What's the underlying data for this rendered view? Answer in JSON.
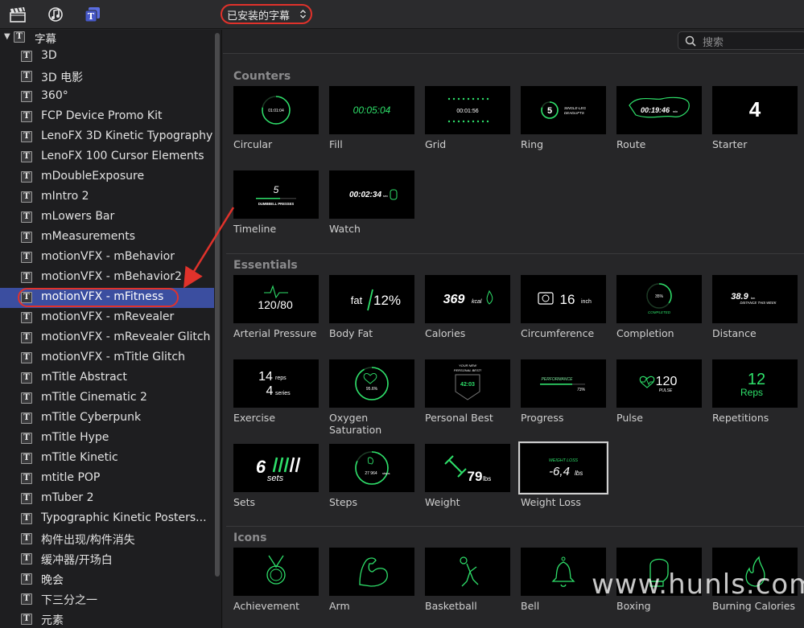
{
  "toolbar": {
    "icons": [
      "clapper-icon",
      "music-icon",
      "titles-icon"
    ],
    "selector_label": "已安装的字幕",
    "accent_color": "#e0322b"
  },
  "sidebar": {
    "header": "字幕",
    "items": [
      {
        "label": "3D"
      },
      {
        "label": "3D 电影"
      },
      {
        "label": "360°"
      },
      {
        "label": "FCP Device Promo Kit"
      },
      {
        "label": "LenoFX 3D Kinetic Typography"
      },
      {
        "label": "LenoFX 100 Cursor Elements"
      },
      {
        "label": "mDoubleExposure"
      },
      {
        "label": "mIntro 2"
      },
      {
        "label": "mLowers Bar"
      },
      {
        "label": "mMeasurements"
      },
      {
        "label": "motionVFX - mBehavior"
      },
      {
        "label": "motionVFX - mBehavior2"
      },
      {
        "label": "motionVFX - mFitness",
        "selected": true
      },
      {
        "label": "motionVFX - mRevealer"
      },
      {
        "label": "motionVFX - mRevealer Glitch"
      },
      {
        "label": "motionVFX - mTitle Glitch"
      },
      {
        "label": "mTitle Abstract"
      },
      {
        "label": "mTitle Cinematic 2"
      },
      {
        "label": "mTitle Cyberpunk"
      },
      {
        "label": "mTitle Hype"
      },
      {
        "label": "mTitle Kinetic"
      },
      {
        "label": "mtitle POP"
      },
      {
        "label": "mTuber 2"
      },
      {
        "label": "Typographic Kinetic Posters..."
      },
      {
        "label": "构件出现/构件消失"
      },
      {
        "label": "缓冲器/开场白"
      },
      {
        "label": "晚会"
      },
      {
        "label": "下三分之一"
      },
      {
        "label": "元素"
      }
    ]
  },
  "search": {
    "placeholder": "搜索"
  },
  "sections": [
    {
      "title": "Counters",
      "tiles": [
        {
          "label": "Circular",
          "thumb": [
            "01:01:04"
          ]
        },
        {
          "label": "Fill",
          "thumb": [
            "00:05:04"
          ]
        },
        {
          "label": "Grid",
          "thumb": [
            "00:01:56"
          ]
        },
        {
          "label": "Ring",
          "thumb": [
            "5",
            "SINGLE-LEG",
            "DEADLIFTS"
          ]
        },
        {
          "label": "Route",
          "thumb": [
            "00:19:46",
            "min"
          ]
        },
        {
          "label": "Starter",
          "thumb": [
            "4"
          ]
        },
        {
          "label": "Timeline",
          "thumb": [
            "5",
            "DUMBBELL PRESSES"
          ]
        },
        {
          "label": "Watch",
          "thumb": [
            "00:02:34",
            "sec"
          ]
        }
      ]
    },
    {
      "title": "Essentials",
      "tiles": [
        {
          "label": "Arterial Pressure",
          "thumb": [
            "120",
            "/80"
          ]
        },
        {
          "label": "Body Fat",
          "thumb": [
            "fat",
            "12%"
          ]
        },
        {
          "label": "Calories",
          "thumb": [
            "369",
            "kcal"
          ]
        },
        {
          "label": "Circumference",
          "thumb": [
            "16",
            "inch"
          ]
        },
        {
          "label": "Completion",
          "thumb": [
            "35%",
            "COMPLETED"
          ]
        },
        {
          "label": "Distance",
          "thumb": [
            "38.9",
            "km",
            "DISTANCE THIS WEEK"
          ]
        },
        {
          "label": "Exercise",
          "thumb": [
            "14",
            "reps",
            "4",
            "series"
          ]
        },
        {
          "label": "Oxygen Saturation",
          "thumb": [
            "95.6%"
          ]
        },
        {
          "label": "Personal Best",
          "thumb": [
            "YOUR NEW",
            "PERSONAL BEST!",
            "42:03"
          ]
        },
        {
          "label": "Progress",
          "thumb": [
            "PERFORMANCE",
            "73%"
          ]
        },
        {
          "label": "Pulse",
          "thumb": [
            "120",
            "PULSE"
          ]
        },
        {
          "label": "Repetitions",
          "thumb": [
            "12",
            "Reps"
          ]
        },
        {
          "label": "Sets",
          "thumb": [
            "6",
            "sets"
          ]
        },
        {
          "label": "Steps",
          "thumb": [
            "27 964",
            "steps"
          ]
        },
        {
          "label": "Weight",
          "thumb": [
            "79",
            "lbs"
          ]
        },
        {
          "label": "Weight Loss",
          "thumb": [
            "WEIGHT LOSS",
            "-6,4",
            "lbs"
          ],
          "selected": true
        }
      ]
    },
    {
      "title": "Icons",
      "tiles": [
        {
          "label": "Achievement",
          "icon": "medal-icon"
        },
        {
          "label": "Arm",
          "icon": "arm-icon"
        },
        {
          "label": "Basketball",
          "icon": "basketball-icon"
        },
        {
          "label": "Bell",
          "icon": "bell-icon"
        },
        {
          "label": "Boxing",
          "icon": "boxing-glove-icon"
        },
        {
          "label": "Burning Calories",
          "icon": "flame-icon"
        }
      ]
    }
  ],
  "watermark": "www.hunls.com",
  "colors": {
    "neon_green": "#2ee06a",
    "selection_blue": "#3b4ea0"
  }
}
